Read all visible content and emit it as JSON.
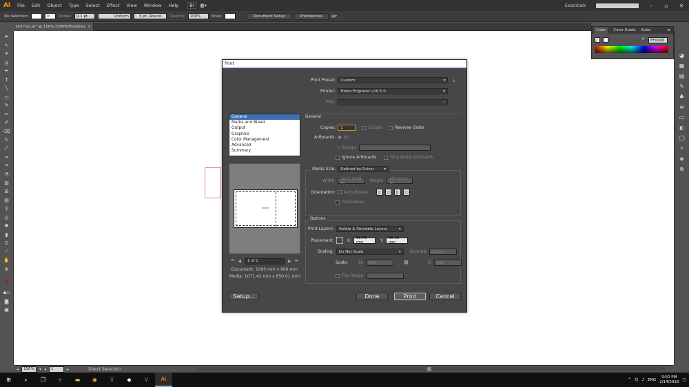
{
  "app": {
    "logo": "Ai",
    "menu": [
      "File",
      "Edit",
      "Object",
      "Type",
      "Select",
      "Effect",
      "View",
      "Window",
      "Help"
    ],
    "workspace": "Essentials",
    "search_placeholder": ""
  },
  "control_bar": {
    "selection": "No Selection",
    "stroke_label": "Stroke:",
    "stroke_value": "0.1 pt",
    "uniform": "Uniform",
    "brush": "5 pt. Round",
    "opacity_label": "Opacity:",
    "opacity_value": "100%",
    "style_label": "Style:",
    "document_setup": "Document Setup",
    "preferences": "Preferences"
  },
  "document_tab": {
    "title": "ktrl fnnl.ai* @ 150% (CMYK/Preview)",
    "close": "×"
  },
  "color_panel": {
    "tabs": [
      "Color",
      "Color Guide",
      "Kuler"
    ],
    "hex": "FF0000"
  },
  "status_bar": {
    "zoom": "150%",
    "page": "1",
    "tool": "Direct Selection"
  },
  "taskbar": {
    "time": "9:50 PM",
    "date": "2/14/2018",
    "lang": "ENG"
  },
  "dialog": {
    "title": "Print",
    "print_preset_label": "Print Preset:",
    "print_preset_value": "Custom",
    "printer_label": "Printer:",
    "printer_value": "Trotec Engraver v10.5.0",
    "ppd_label": "PPD:",
    "categories": [
      "General",
      "Marks and Bleed",
      "Output",
      "Graphics",
      "Color Management",
      "Advanced",
      "Summary"
    ],
    "section": "General",
    "copies_label": "Copies:",
    "copies_value": "1",
    "collate": "Collate",
    "reverse_order": "Reverse Order",
    "artboards_label": "Artboards:",
    "all": "All",
    "range": "Range:",
    "ignore_artboards": "Ignore Artboards",
    "skip_blank": "Skip Blank Artboards",
    "media_size_label": "Media Size:",
    "media_size_value": "Defined by Driver",
    "width_label": "Width:",
    "width_value": "1071.4228 m",
    "height_label": "Height:",
    "height_value": "650.0114 m",
    "orientation_label": "Orientation:",
    "auto_rotate": "Auto-Rotate",
    "transverse": "Transverse",
    "options_title": "Options",
    "print_layers_label": "Print Layers:",
    "print_layers_value": "Visible & Printable Layers",
    "placement_label": "Placement:",
    "x_label": "X:",
    "x_value": "35.71 mm",
    "y_label": "Y:",
    "y_value": "25.01 mm",
    "scaling_label": "Scaling:",
    "scaling_value": "Do Not Scale",
    "overlap_label": "Overlap:",
    "overlap_value": "0 mm",
    "scale_label": "Scale:",
    "w_label": "W:",
    "w_value": "100",
    "h_label": "H:",
    "h_value": "100",
    "tile_range": "Tile Range:",
    "pagenav": "1 of 1",
    "doc_info": "Document: 1000 mm x 600 mm",
    "media_info": "Media: 1071.42 mm x 650.01 mm",
    "setup_button": "Setup...",
    "done_button": "Done",
    "print_button": "Print",
    "cancel_button": "Cancel"
  }
}
